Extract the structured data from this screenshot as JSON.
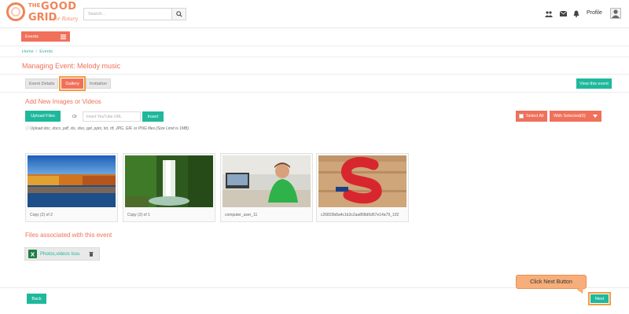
{
  "header": {
    "logo": {
      "the": "THE",
      "good": "GOOD",
      "grid": "GRID",
      "sub": "for Rotary"
    },
    "search": {
      "placeholder": "Search..."
    },
    "profile_label": "Profile"
  },
  "nav": {
    "events_label": "Events"
  },
  "breadcrumb": {
    "home": "Home",
    "separator": "/",
    "events": "Events"
  },
  "page": {
    "title": "Managing Event: Melody music"
  },
  "tabs": [
    {
      "label": "Event Details",
      "active": false
    },
    {
      "label": "Gallery",
      "active": true
    },
    {
      "label": "Invitation",
      "active": false
    }
  ],
  "view_event_label": "View this event",
  "upload_section": {
    "title": "Add New Images or Videos",
    "upload_label": "Upload Files",
    "or_label": "Or",
    "youtube_placeholder": "Insert YouTube URL",
    "insert_label": "Insert",
    "note": "Upload doc, docx, pdf, xls, xlsx, ppt, pptx, txt, rtf, JPG, GIF, or PNG files.(Size Limit is 1MB)"
  },
  "select_all_label": "Select All",
  "with_selected_label": "With Selected(0)",
  "gallery": [
    {
      "caption": "Copy (2) of 2"
    },
    {
      "caption": "Copy (2) of 1"
    },
    {
      "caption": "computer_user_11"
    },
    {
      "caption": "c26820b8a4c1b3c2aa868d6d57e14a79_102"
    }
  ],
  "files_section": {
    "title": "Files associated with this event",
    "file_name": "Photos,videos Issu"
  },
  "footer": {
    "back_label": "Back",
    "next_label": "Next",
    "callout": "Click Next Button"
  },
  "colors": {
    "accent": "#f0705a",
    "teal": "#1fb89c",
    "highlight": "#f39c3f"
  }
}
